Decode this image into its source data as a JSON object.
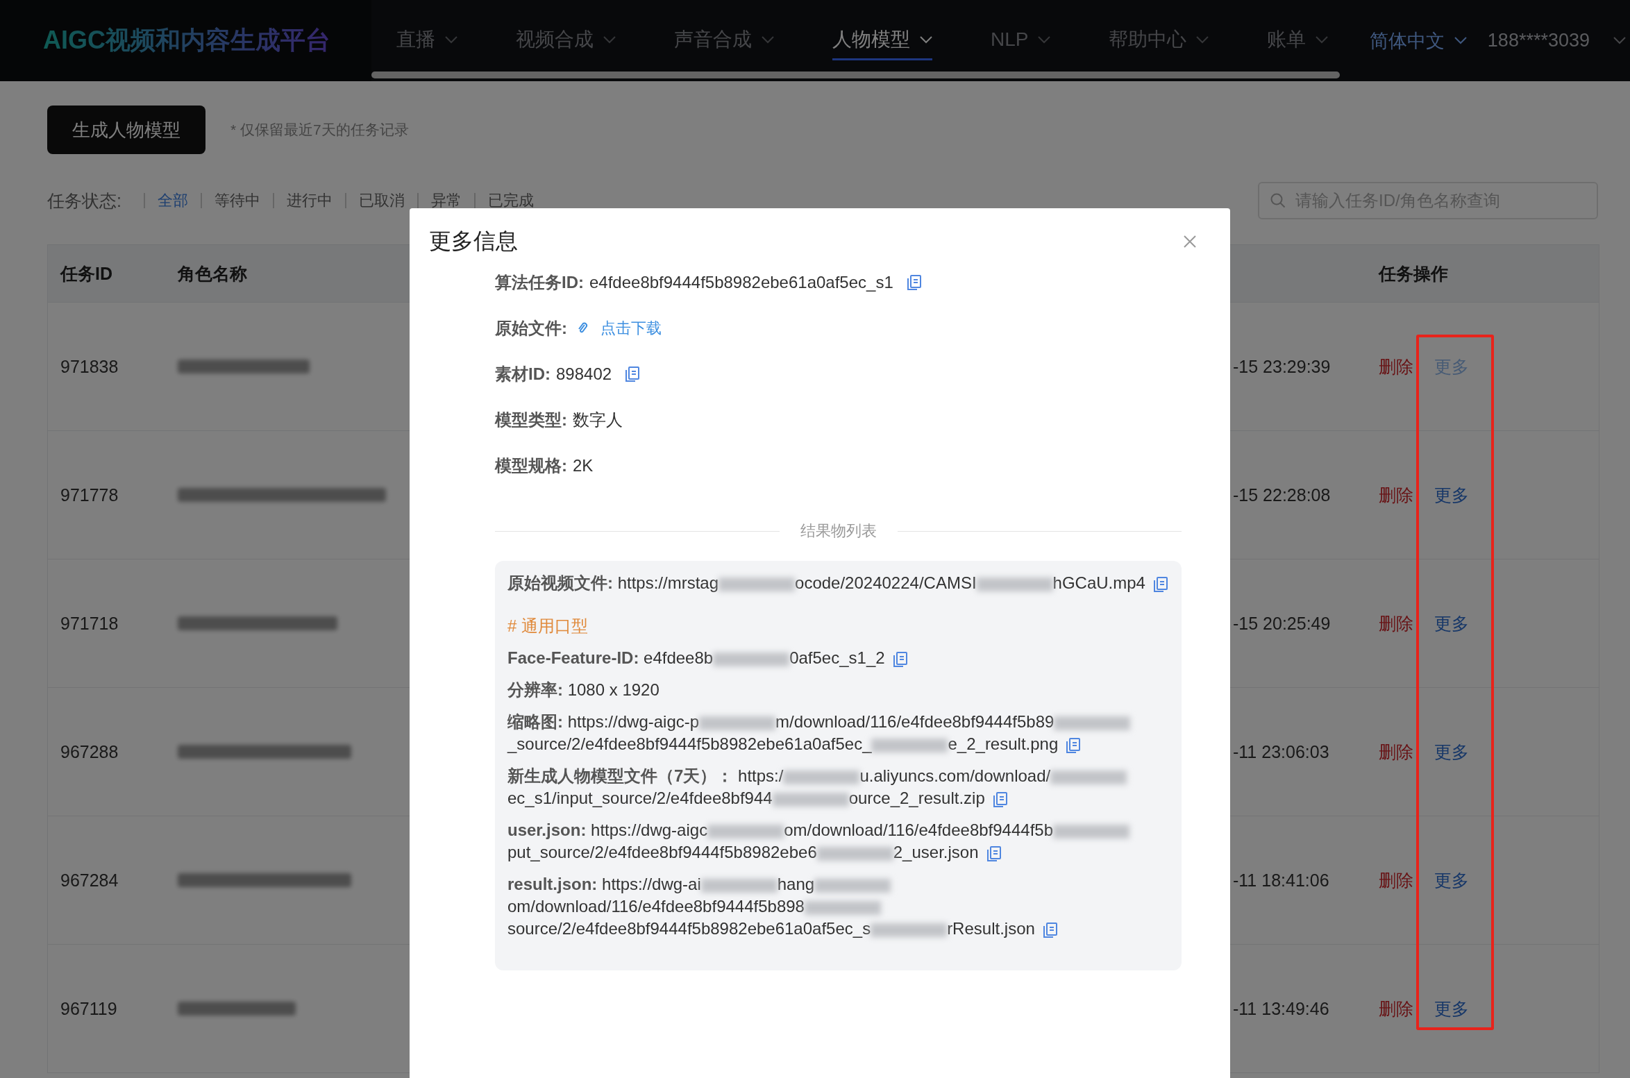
{
  "nav": {
    "logo": "AIGC视频和内容生成平台",
    "items": [
      {
        "label": "直播",
        "selected": false
      },
      {
        "label": "视频合成",
        "selected": false
      },
      {
        "label": "声音合成",
        "selected": false
      },
      {
        "label": "人物模型",
        "selected": true
      },
      {
        "label": "NLP",
        "selected": false
      },
      {
        "label": "帮助中心",
        "selected": false
      },
      {
        "label": "账单",
        "selected": false
      }
    ],
    "language": "简体中文",
    "account": "188****3039"
  },
  "toolbar": {
    "create_button": "生成人物模型",
    "note": "* 仅保留最近7天的任务记录"
  },
  "filter": {
    "label": "任务状态:",
    "options": [
      {
        "label": "全部",
        "selected": true
      },
      {
        "label": "等待中",
        "selected": false
      },
      {
        "label": "进行中",
        "selected": false
      },
      {
        "label": "已取消",
        "selected": false
      },
      {
        "label": "异常",
        "selected": false
      },
      {
        "label": "已完成",
        "selected": false
      }
    ]
  },
  "search": {
    "placeholder": "请输入任务ID/角色名称查询"
  },
  "table": {
    "id_header": "任务ID",
    "name_header": "角色名称",
    "action_header": "任务操作",
    "rows": [
      {
        "task_id": "971838",
        "time": "-15 23:29:39",
        "actions": [
          "删除",
          "更多"
        ],
        "active": true
      },
      {
        "task_id": "971778",
        "time": "-15 22:28:08",
        "actions": [
          "删除",
          "更多"
        ],
        "active": false
      },
      {
        "task_id": "971718",
        "time": "-15 20:25:49",
        "actions": [
          "删除",
          "更多"
        ],
        "active": false
      },
      {
        "task_id": "967288",
        "time": "-11 23:06:03",
        "actions": [
          "删除",
          "更多"
        ],
        "active": false
      },
      {
        "task_id": "967284",
        "time": "-11 18:41:06",
        "actions": [
          "删除",
          "更多"
        ],
        "active": false
      },
      {
        "task_id": "967119",
        "time": "-11 13:49:46",
        "actions": [
          "删除",
          "更多"
        ],
        "active": false
      }
    ]
  },
  "modal": {
    "title": "更多信息",
    "fields": [
      {
        "kind": "text",
        "label": "算法任务ID:",
        "value": "e4fdee8bf9444f5b8982ebe61a0af5ec_s1",
        "copy": true
      },
      {
        "kind": "link",
        "label": "原始文件:",
        "value": "点击下载",
        "copy": false
      },
      {
        "kind": "text",
        "label": "素材ID:",
        "value": "898402",
        "copy": true
      },
      {
        "kind": "text",
        "label": "模型类型:",
        "value": "数字人",
        "copy": false
      },
      {
        "kind": "text",
        "label": "模型规格:",
        "value": "2K",
        "copy": false
      }
    ],
    "divider": "结果物列表",
    "results": [
      {
        "kind": "entry",
        "label": "原始视频文件:",
        "parts": [
          "https://mrstag",
          "ocode/20240224/CAMSI",
          "hGCaU.mp4"
        ],
        "copy": true
      },
      {
        "kind": "heading",
        "text": "# 通用口型"
      },
      {
        "kind": "entry",
        "label": "Face-Feature-ID:",
        "parts": [
          "e4fdee8b",
          "0af5ec_s1_2"
        ],
        "copy": true
      },
      {
        "kind": "entry",
        "label": "分辨率:",
        "parts": [
          "1080 x 1920"
        ],
        "copy": false
      },
      {
        "kind": "entry",
        "label": "缩略图:",
        "parts": [
          "https://dwg-aigc-p",
          "m/download/116/e4fdee8bf9444f5b89",
          "_source/2/e4fdee8bf9444f5b8982ebe61a0af5ec_",
          "e_2_result.png"
        ],
        "copy": true
      },
      {
        "kind": "entry",
        "label": "新生成人物模型文件（7天）：",
        "parts": [
          "https:/",
          "u.aliyuncs.com/download/",
          "ec_s1/input_source/2/e4fdee8bf944",
          "ource_2_result.zip"
        ],
        "copy": true
      },
      {
        "kind": "entry",
        "label": "user.json:",
        "parts": [
          "https://dwg-aigc",
          "om/download/116/e4fdee8bf9444f5b",
          "put_source/2/e4fdee8bf9444f5b8982ebe6",
          "2_user.json"
        ],
        "copy": true
      },
      {
        "kind": "entry",
        "label": "result.json:",
        "parts": [
          "https://dwg-ai",
          "hang",
          "om/download/116/e4fdee8bf9444f5b898",
          "source/2/e4fdee8bf9444f5b8982ebe61a0af5ec_s",
          "rResult.json"
        ],
        "copy": true
      }
    ]
  }
}
